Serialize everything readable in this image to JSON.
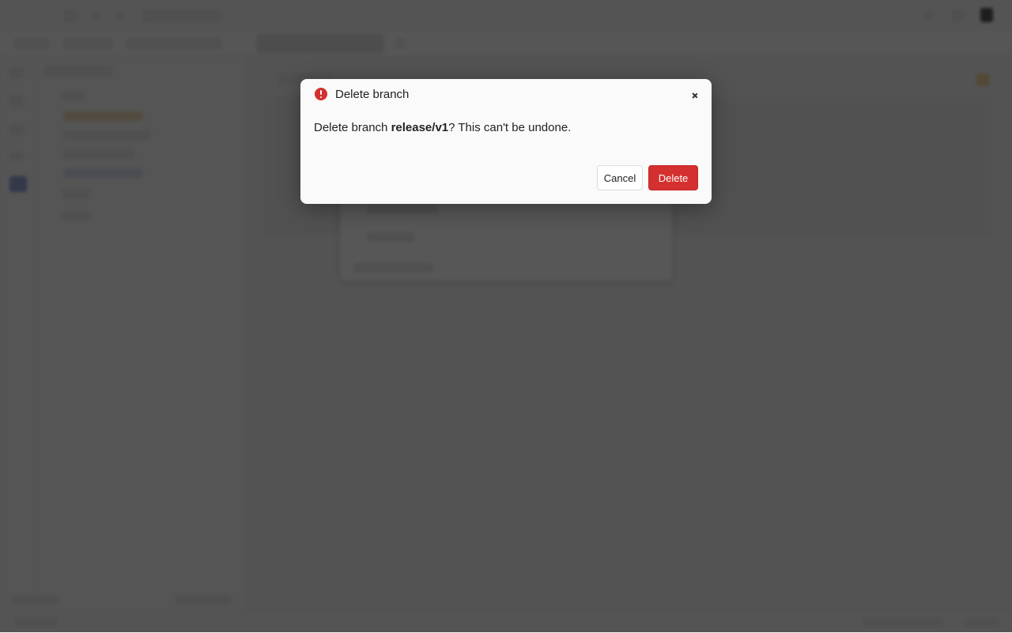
{
  "dialog": {
    "title": "Delete branch",
    "message_prefix": "Delete branch ",
    "branch_name": "release/v1",
    "message_suffix": "? This can't be undone.",
    "cancel_label": "Cancel",
    "delete_label": "Delete",
    "danger_color": "#d3302f"
  }
}
